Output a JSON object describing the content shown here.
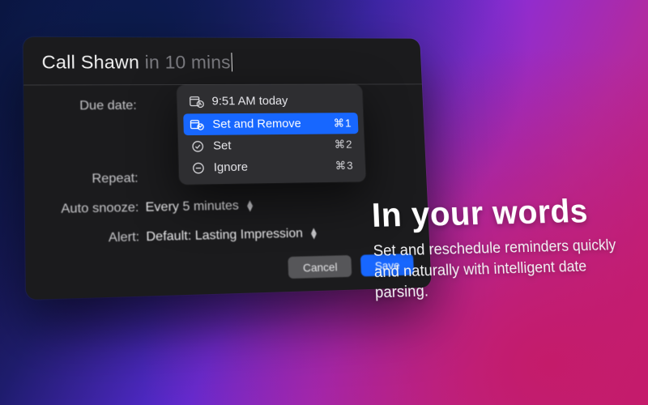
{
  "dialog": {
    "title_typed": "Call Shawn ",
    "title_suggestion": "in 10 mins",
    "fields": {
      "due_date": {
        "label": "Due date:"
      },
      "repeat": {
        "label": "Repeat:"
      },
      "auto_snooze": {
        "label": "Auto snooze:",
        "value": "Every 5 minutes"
      },
      "alert": {
        "label": "Alert:",
        "value": "Default: Lasting Impression"
      }
    },
    "buttons": {
      "cancel": "Cancel",
      "save": "Save"
    }
  },
  "popover": {
    "header_icon": "calendar-clock-icon",
    "parsed_time": "9:51 AM today",
    "actions": [
      {
        "icon": "set-remove-icon",
        "label": "Set and Remove",
        "shortcut": "⌘1",
        "selected": true
      },
      {
        "icon": "check-icon",
        "label": "Set",
        "shortcut": "⌘2",
        "selected": false
      },
      {
        "icon": "ignore-icon",
        "label": "Ignore",
        "shortcut": "⌘3",
        "selected": false
      }
    ]
  },
  "marketing": {
    "headline": "In your words",
    "body": "Set and reschedule reminders quickly and naturally with intelligent date parsing."
  }
}
